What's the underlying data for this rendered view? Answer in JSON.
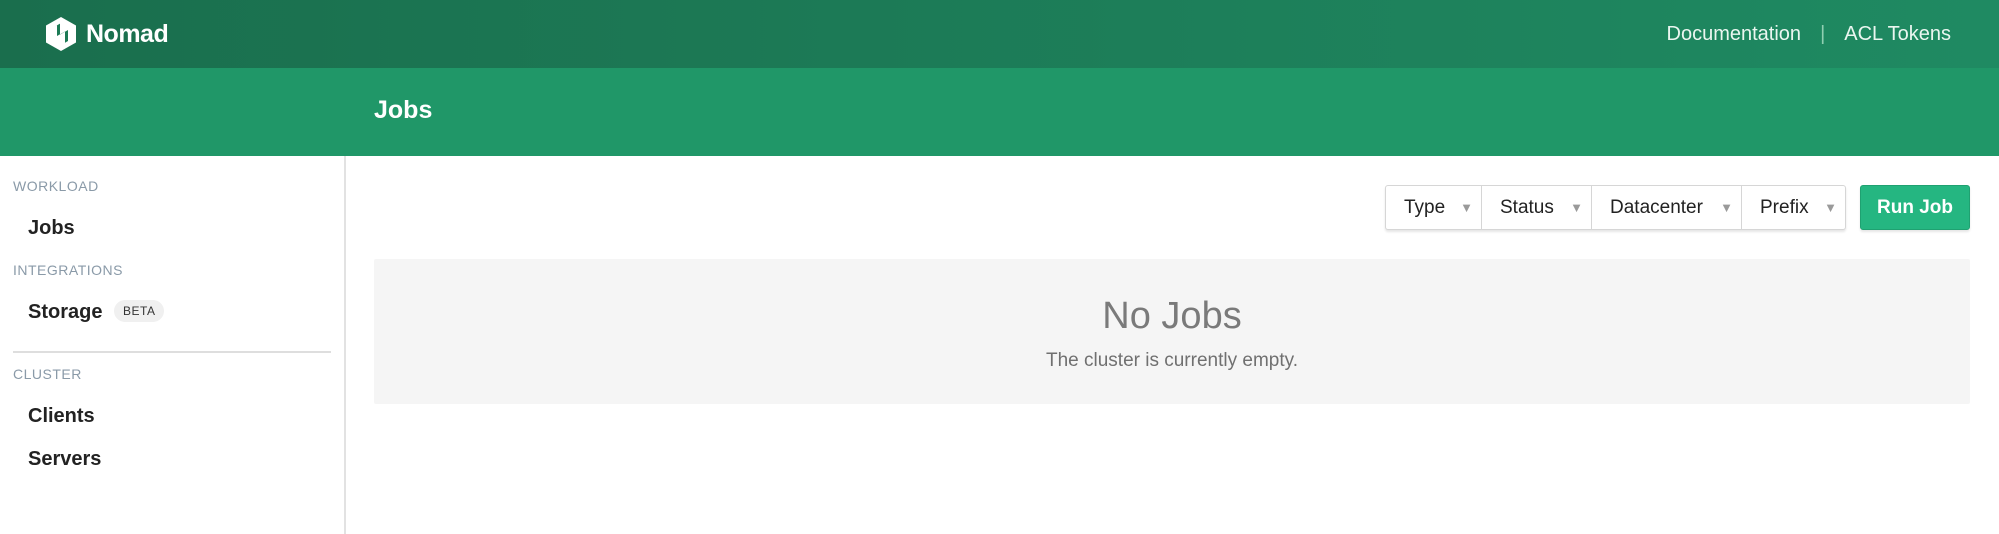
{
  "app": {
    "name": "Nomad",
    "logo_icon": "nomad-logo-icon",
    "colors": {
      "nav_dark": "#1a6e4d",
      "subheader": "#209768",
      "accent_button": "#25b681"
    }
  },
  "topnav": {
    "links": [
      {
        "label": "Documentation"
      },
      {
        "label": "ACL Tokens"
      }
    ],
    "separator": "|"
  },
  "page": {
    "title": "Jobs"
  },
  "sidebar": {
    "sections": [
      {
        "label": "WORKLOAD",
        "items": [
          {
            "label": "Jobs"
          }
        ]
      },
      {
        "label": "INTEGRATIONS",
        "items": [
          {
            "label": "Storage",
            "badge": "BETA"
          }
        ]
      },
      {
        "label": "CLUSTER",
        "items": [
          {
            "label": "Clients"
          },
          {
            "label": "Servers"
          }
        ]
      }
    ]
  },
  "toolbar": {
    "filters": [
      {
        "label": "Type",
        "icon": "caret-down-icon"
      },
      {
        "label": "Status",
        "icon": "caret-down-icon"
      },
      {
        "label": "Datacenter",
        "icon": "caret-down-icon"
      },
      {
        "label": "Prefix",
        "icon": "caret-down-icon"
      }
    ],
    "run_job_label": "Run Job"
  },
  "empty_state": {
    "title": "No Jobs",
    "message": "The cluster is currently empty."
  }
}
